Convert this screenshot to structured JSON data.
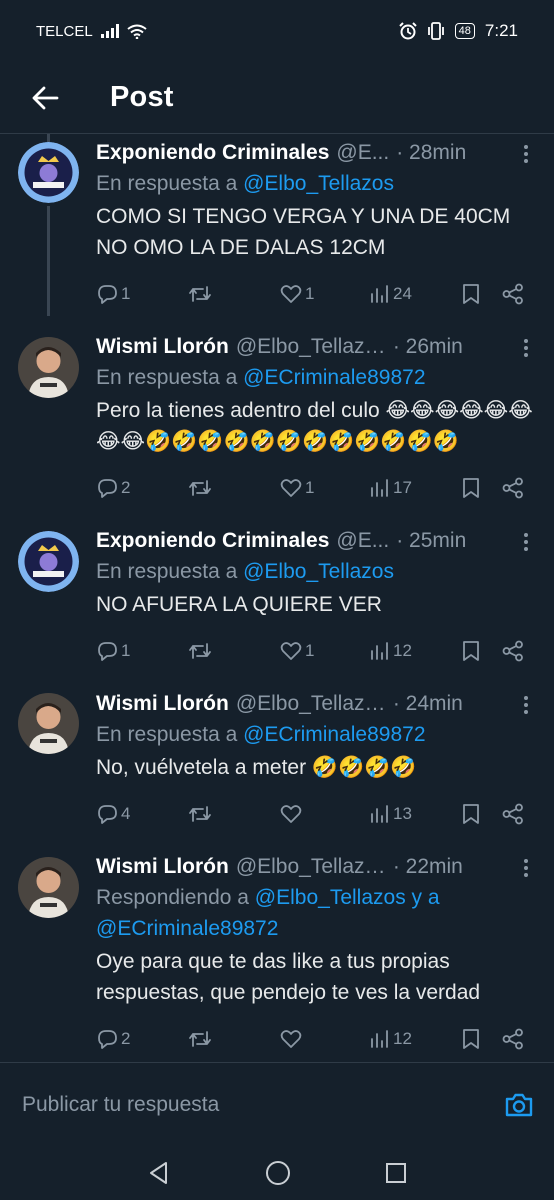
{
  "status": {
    "carrier": "TELCEL",
    "battery": "48",
    "time": "7:21",
    "icons": [
      "signal-icon",
      "wifi-icon",
      "alarm-icon",
      "vibrate-icon",
      "battery-icon"
    ]
  },
  "header": {
    "title": "Post",
    "back_icon": "back-arrow-icon"
  },
  "tweets": [
    {
      "name": "Exponiendo Criminales",
      "handle": "@E...",
      "time": "· 28min",
      "reply_prefix": "En respuesta a ",
      "reply_mention": "@Elbo_Tellazos",
      "reply_suffix": "",
      "reply_mention2": "",
      "text": "COMO SI TENGO VERGA Y UNA DE 40CM NO OMO LA DE DALAS 12CM",
      "replies": "1",
      "retweets": "",
      "likes": "1",
      "views": "24"
    },
    {
      "name": "Wismi Llorón",
      "handle": "@Elbo_Tellazos",
      "time": "· 26min",
      "reply_prefix": "En respuesta a ",
      "reply_mention": "@ECriminale89872",
      "reply_suffix": "",
      "reply_mention2": "",
      "text": "Pero la tienes adentro del culo 😂😂😂😂😂😂😂😂🤣🤣🤣🤣🤣🤣🤣🤣🤣🤣🤣🤣",
      "replies": "2",
      "retweets": "",
      "likes": "1",
      "views": "17"
    },
    {
      "name": "Exponiendo Criminales",
      "handle": "@E...",
      "time": "· 25min",
      "reply_prefix": "En respuesta a ",
      "reply_mention": "@Elbo_Tellazos",
      "reply_suffix": "",
      "reply_mention2": "",
      "text": "NO AFUERA LA QUIERE VER",
      "replies": "1",
      "retweets": "",
      "likes": "1",
      "views": "12"
    },
    {
      "name": "Wismi Llorón",
      "handle": "@Elbo_Tellazos",
      "time": "· 24min",
      "reply_prefix": "En respuesta a ",
      "reply_mention": "@ECriminale89872",
      "reply_suffix": "",
      "reply_mention2": "",
      "text": "No, vuélvetela a meter 🤣🤣🤣🤣",
      "replies": "4",
      "retweets": "",
      "likes": "",
      "views": "13"
    },
    {
      "name": "Wismi Llorón",
      "handle": "@Elbo_Tellazos",
      "time": "· 22min",
      "reply_prefix": "Respondiendo a ",
      "reply_mention": "@Elbo_Tellazos y a",
      "reply_suffix": " ",
      "reply_mention2": "@ECriminale89872",
      "text": "Oye para que te das like a tus propias respuestas, que pendejo te ves la verdad",
      "replies": "2",
      "retweets": "",
      "likes": "",
      "views": "12"
    }
  ],
  "composer": {
    "placeholder": "Publicar tu respuesta",
    "camera_icon": "camera-icon"
  },
  "nav": {
    "icons": [
      "nav-back-icon",
      "nav-home-icon",
      "nav-recents-icon"
    ]
  },
  "colors": {
    "background": "#15202b",
    "accent": "#1d9bf0",
    "muted": "#8b98a5",
    "text": "#e7e9ea"
  }
}
